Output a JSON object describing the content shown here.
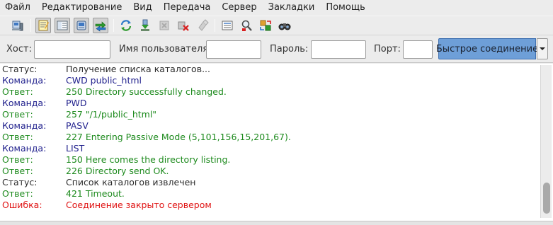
{
  "menu": [
    "Файл",
    "Редактирование",
    "Вид",
    "Передача",
    "Сервер",
    "Закладки",
    "Помощь"
  ],
  "toolbar": {
    "buttons": [
      {
        "name": "site-manager-icon"
      },
      {
        "name": "toggle-message-log-icon"
      },
      {
        "name": "toggle-local-tree-icon"
      },
      {
        "name": "toggle-remote-tree-icon"
      },
      {
        "name": "toggle-transfer-queue-icon"
      },
      {
        "name": "refresh-icon"
      },
      {
        "name": "process-queue-icon"
      },
      {
        "name": "cancel-operation-icon"
      },
      {
        "name": "disconnect-icon"
      },
      {
        "name": "reconnect-icon"
      },
      {
        "name": "directory-filter-icon"
      },
      {
        "name": "compare-directories-icon"
      },
      {
        "name": "synchronized-browsing-icon"
      },
      {
        "name": "search-remote-files-icon"
      }
    ]
  },
  "quickconnect": {
    "host_label": "Хост:",
    "host_value": "",
    "user_label": "Имя пользователя",
    "user_value": "",
    "password_label": "Пароль:",
    "password_value": "",
    "port_label": "Порт:",
    "port_value": "",
    "connect_label": "Быстрое соединение"
  },
  "log": [
    {
      "type": "Статус:",
      "msg": "Получение списка каталогов...",
      "kind": "status"
    },
    {
      "type": "Команда:",
      "msg": "CWD public_html",
      "kind": "command"
    },
    {
      "type": "Ответ:",
      "msg": "250 Directory successfully changed.",
      "kind": "response"
    },
    {
      "type": "Команда:",
      "msg": "PWD",
      "kind": "command"
    },
    {
      "type": "Ответ:",
      "msg": "257 \"/1/public_html\"",
      "kind": "response"
    },
    {
      "type": "Команда:",
      "msg": "PASV",
      "kind": "command"
    },
    {
      "type": "Ответ:",
      "msg": "227 Entering Passive Mode (5,101,156,15,201,67).",
      "kind": "response"
    },
    {
      "type": "Команда:",
      "msg": "LIST",
      "kind": "command"
    },
    {
      "type": "Ответ:",
      "msg": "150 Here comes the directory listing.",
      "kind": "response"
    },
    {
      "type": "Ответ:",
      "msg": "226 Directory send OK.",
      "kind": "response"
    },
    {
      "type": "Статус:",
      "msg": "Список каталогов извлечен",
      "kind": "status"
    },
    {
      "type": "Ответ:",
      "msg": "421 Timeout.",
      "kind": "response"
    },
    {
      "type": "Ошибка:",
      "msg": "Соединение закрыто сервером",
      "kind": "error"
    }
  ],
  "colors": {
    "status": "#2c2c2c",
    "command": "#1f1f8c",
    "response": "#1d8a1d",
    "error": "#e01414",
    "connect_button": "#6e9fd8"
  }
}
